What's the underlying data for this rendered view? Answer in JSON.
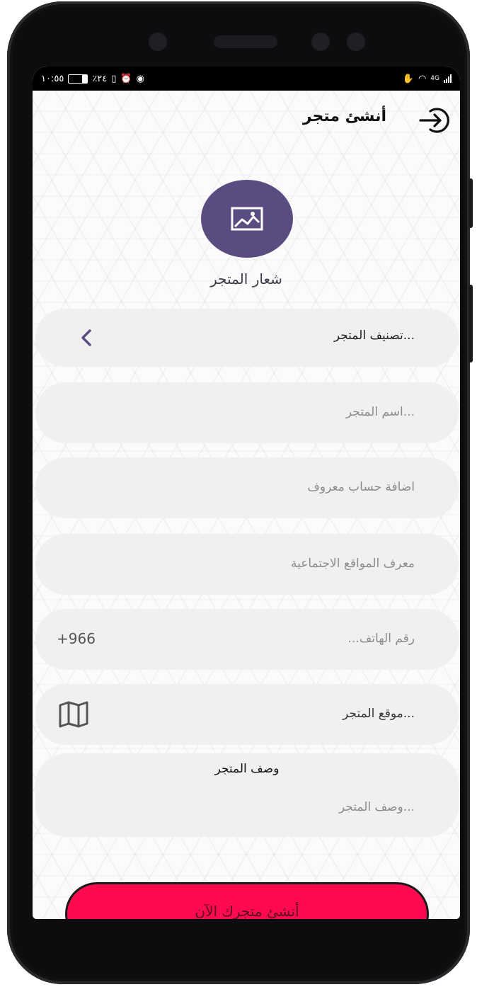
{
  "status_bar": {
    "time": "١٠:٥٥",
    "battery": "٪٢٤",
    "network": "4G"
  },
  "header": {
    "title": "أنشئ متجر",
    "back_icon": "sign-in-arrow-icon"
  },
  "logo": {
    "icon": "image-icon",
    "label": "شعار المتجر",
    "circle_color": "#5a4c80"
  },
  "form": {
    "category": {
      "placeholder": "تصنيف المتجر...",
      "icon": "chevron-left-icon"
    },
    "store_name": {
      "placeholder": "اسم المتجر..."
    },
    "known_account": {
      "placeholder": "اضافة حساب معروف"
    },
    "social_id": {
      "placeholder": "معرف المواقع الاجتماعية"
    },
    "phone": {
      "placeholder": "...رقم الهاتف",
      "country_code": "+966"
    },
    "location": {
      "placeholder": "موقع المتجر...",
      "icon": "map-icon"
    },
    "description": {
      "label": "وصف المتجر",
      "placeholder": "وصف المتجر..."
    }
  },
  "cta": {
    "label": "أنشئ متجرك الآن",
    "color": "#ff0a4e"
  }
}
